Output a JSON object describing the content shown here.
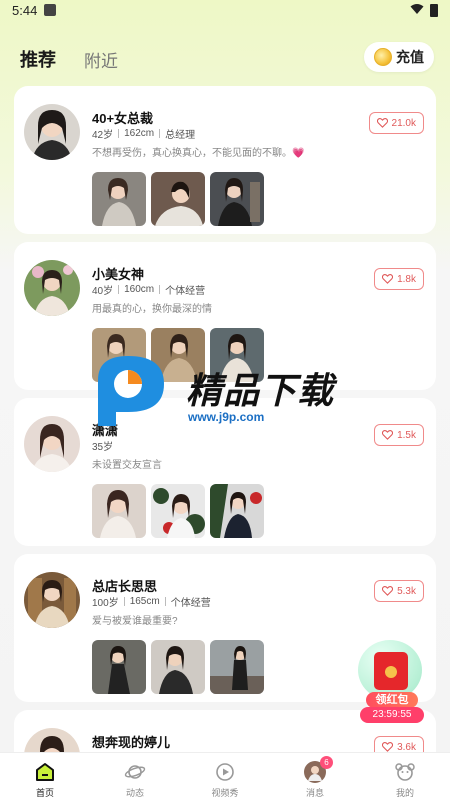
{
  "status_bar": {
    "time": "5:44"
  },
  "tabs": {
    "recommend": "推荐",
    "nearby": "附近"
  },
  "recharge": {
    "label": "充值"
  },
  "profiles": [
    {
      "name": "40+女总裁",
      "age": "42岁",
      "height": "162cm",
      "job": "总经理",
      "bio": "不想再受伤，真心换真心，不能见面的不聊。💗",
      "likes": "21.0k"
    },
    {
      "name": "小美女神",
      "age": "40岁",
      "height": "160cm",
      "job": "个体经营",
      "bio": "用最真的心，换你最深的情",
      "likes": "1.8k"
    },
    {
      "name": "潇潇",
      "age": "35岁",
      "bio": "未设置交友宣言",
      "likes": "1.5k"
    },
    {
      "name": "总店长思思",
      "age": "100岁",
      "height": "165cm",
      "job": "个体经营",
      "bio": "爱与被爱谁最重要?",
      "likes": "5.3k"
    },
    {
      "name": "想奔现的婷儿",
      "likes": "3.6k"
    }
  ],
  "watermark": {
    "title": "精品下载",
    "url": "www.j9p.com"
  },
  "red_packet": {
    "label": "领红包",
    "timer": "23:59:55"
  },
  "bottom_nav": [
    {
      "label": "首页",
      "icon": "home-icon"
    },
    {
      "label": "动态",
      "icon": "planet-icon"
    },
    {
      "label": "视频秀",
      "icon": "video-icon"
    },
    {
      "label": "消息",
      "icon": "avatar-icon",
      "badge": "6"
    },
    {
      "label": "我的",
      "icon": "bear-icon"
    }
  ],
  "colors": {
    "accent": "#e05a5a",
    "badge": "#ff4f7a",
    "bg_top": "#eef8c6"
  }
}
